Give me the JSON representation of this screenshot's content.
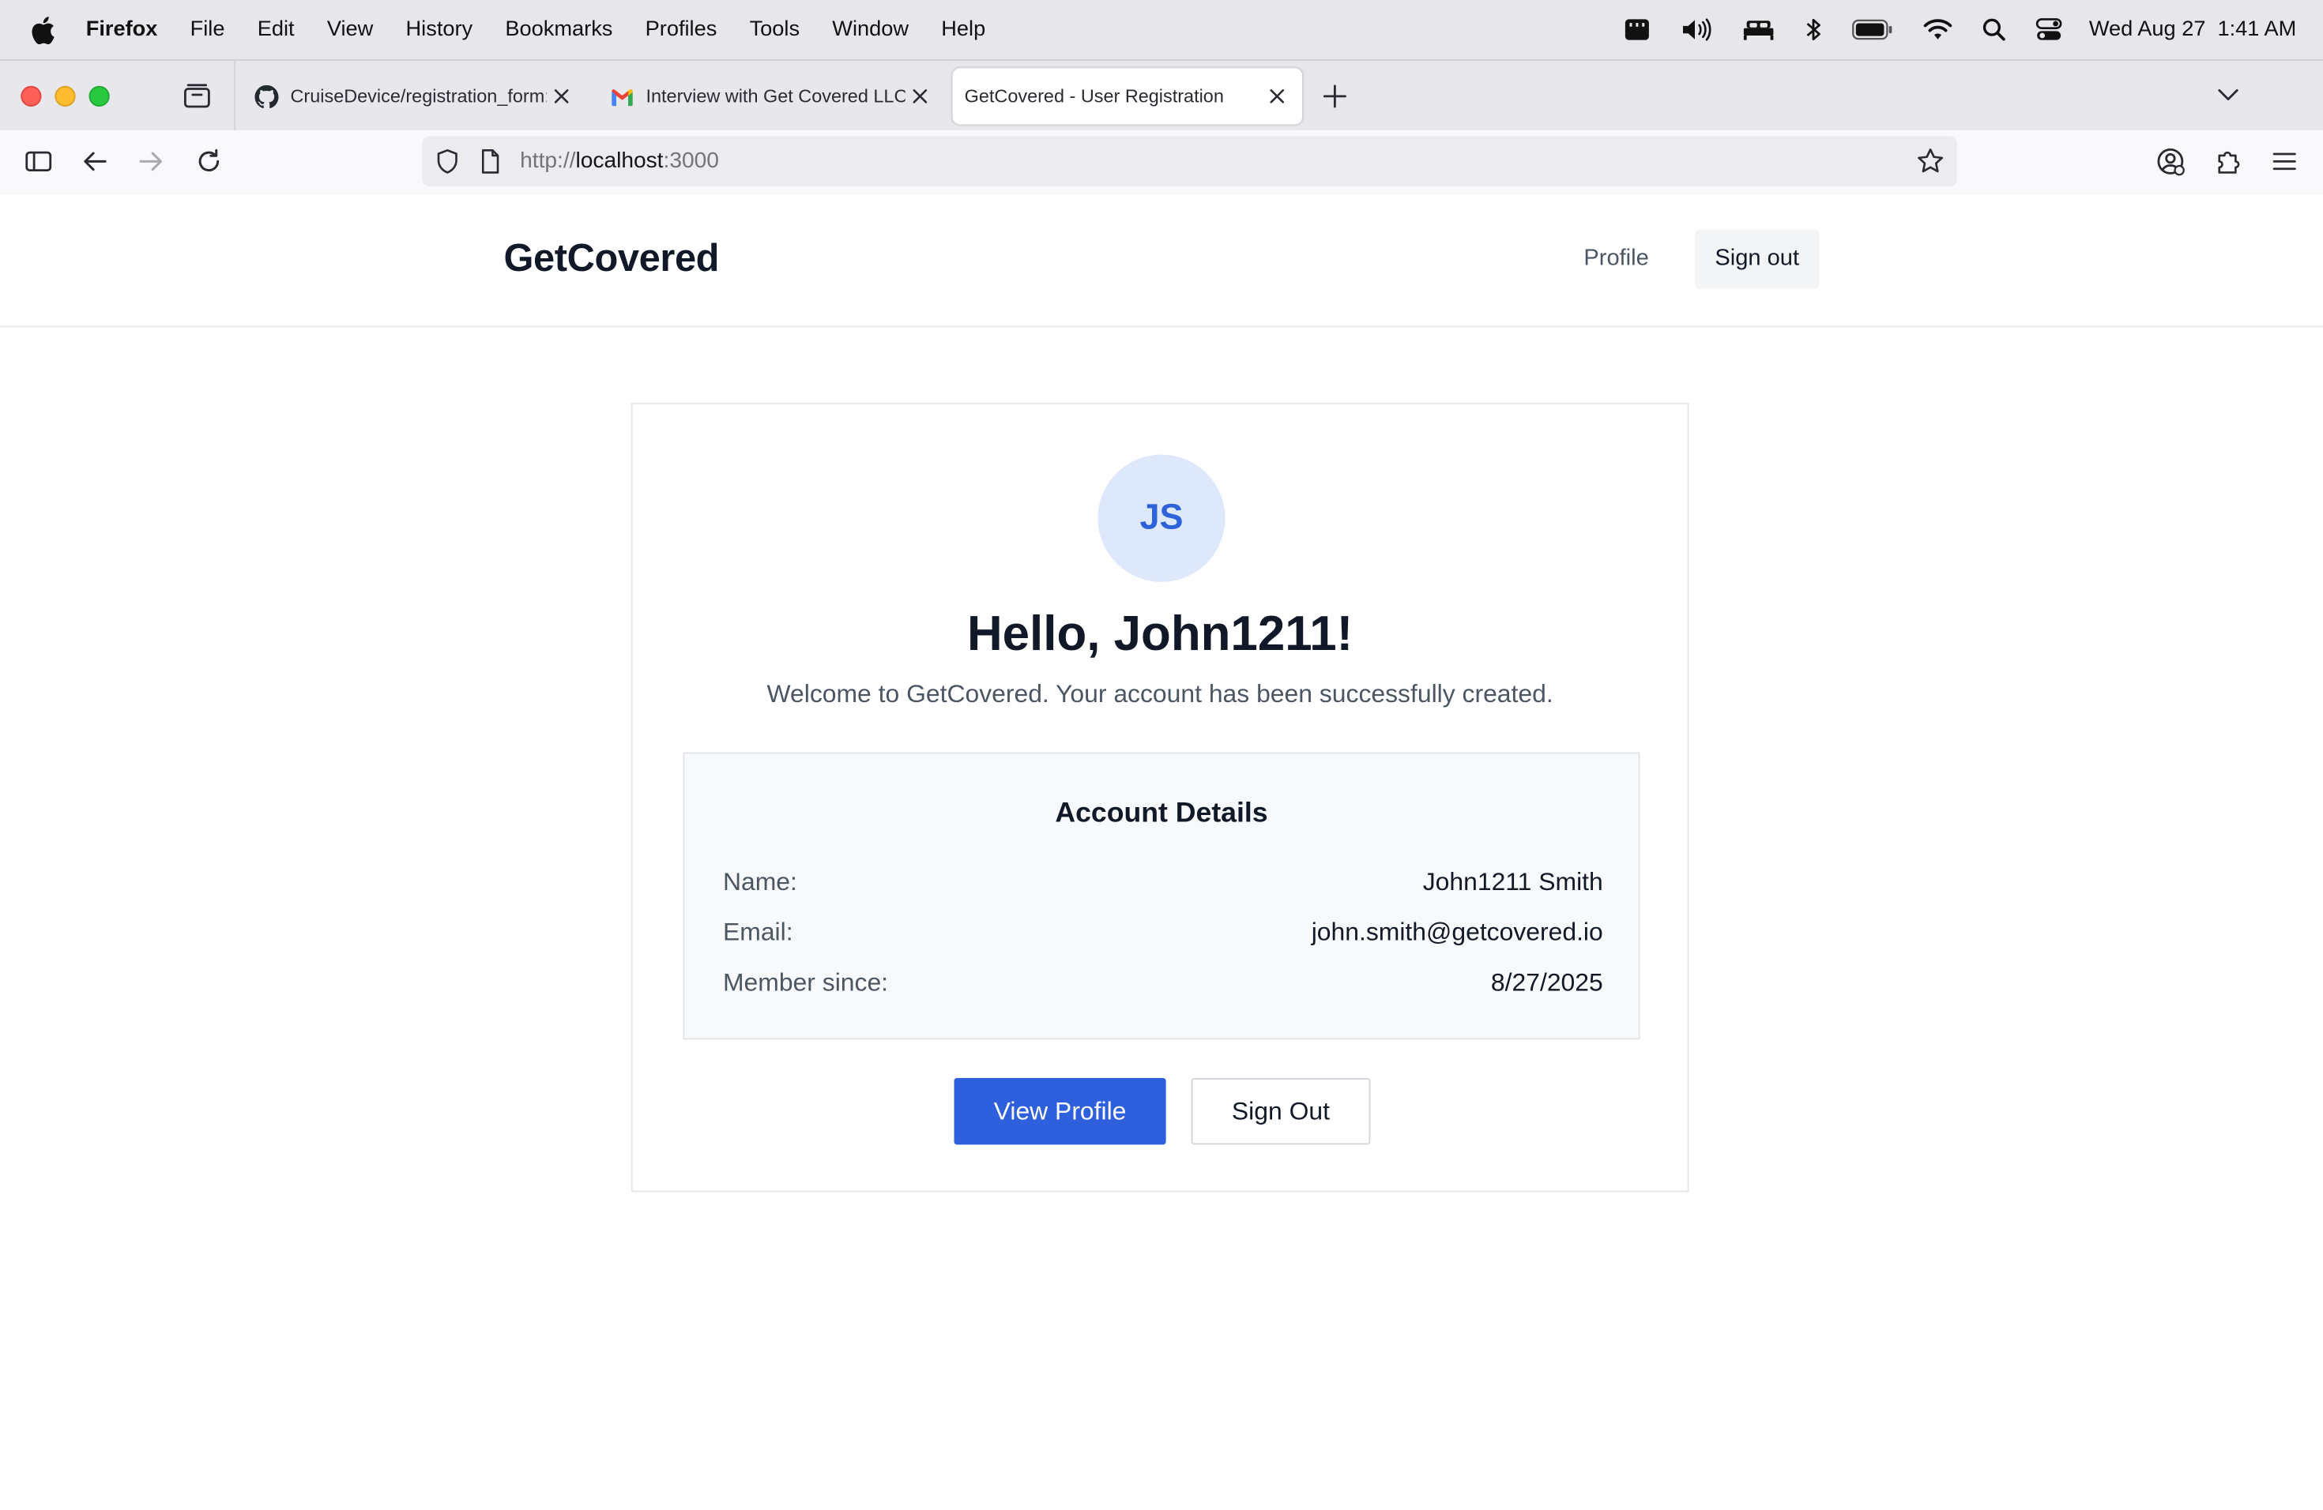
{
  "menubar": {
    "app_name": "Firefox",
    "items": [
      "File",
      "Edit",
      "View",
      "History",
      "Bookmarks",
      "Profiles",
      "Tools",
      "Window",
      "Help"
    ],
    "date": "Wed Aug 27",
    "time": "1:41 AM"
  },
  "tabs": [
    {
      "title": "CruiseDevice/registration_form:",
      "favicon": "github-icon",
      "active": false
    },
    {
      "title": "Interview with Get Covered LLC",
      "favicon": "gmail-icon",
      "active": false
    },
    {
      "title": "GetCovered - User Registration",
      "favicon": "",
      "active": true
    }
  ],
  "urlbar": {
    "scheme": "http://",
    "host": "localhost",
    "port": ":3000"
  },
  "site": {
    "logo": "GetCovered",
    "nav_profile": "Profile",
    "nav_signout": "Sign out"
  },
  "card": {
    "avatar_initials": "JS",
    "greeting": "Hello, John1211!",
    "welcome": "Welcome to GetCovered. Your account has been successfully created.",
    "details_title": "Account Details",
    "details": [
      {
        "label": "Name:",
        "value": "John1211 Smith"
      },
      {
        "label": "Email:",
        "value": "john.smith@getcovered.io"
      },
      {
        "label": "Member since:",
        "value": "8/27/2025"
      }
    ],
    "view_profile_label": "View Profile",
    "sign_out_label": "Sign Out"
  },
  "colors": {
    "primary": "#2e5fdd",
    "avatar_bg": "#dde8fb",
    "avatar_text": "#2e62d9"
  }
}
